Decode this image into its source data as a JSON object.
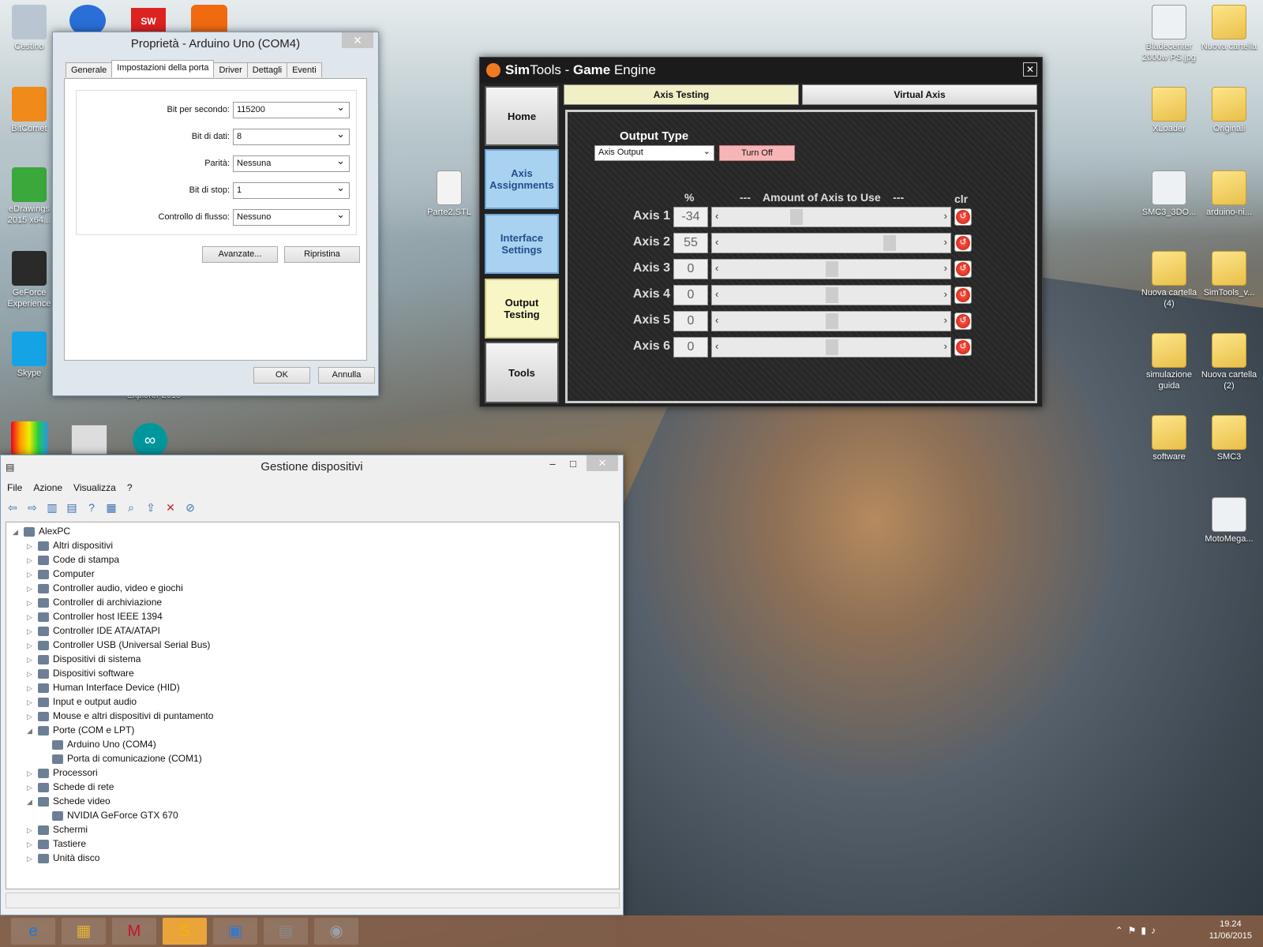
{
  "desktop": {
    "left_icons": [
      {
        "label": "Cestino",
        "icon": "recycle-bin-icon"
      },
      {
        "label": "BitComet",
        "icon": "bitcomet-icon"
      },
      {
        "label": "eDrawings 2015 x64...",
        "icon": "edrawings-icon"
      },
      {
        "label": "GeForce Experience",
        "icon": "geforce-icon"
      },
      {
        "label": "Skype",
        "icon": "skype-icon"
      }
    ],
    "right_icons": [
      {
        "label": "Bladecenter 2000w PS.jpg",
        "icon": "image-file-icon"
      },
      {
        "label": "Nuova cartella",
        "icon": "folder-icon"
      },
      {
        "label": "XLoader",
        "icon": "folder-icon"
      },
      {
        "label": "Originali",
        "icon": "folder-icon"
      },
      {
        "label": "SMC3_3DO...",
        "icon": "image-file-icon"
      },
      {
        "label": "arduino-ni...",
        "icon": "folder-icon"
      },
      {
        "label": "Nuova cartella (4)",
        "icon": "folder-icon"
      },
      {
        "label": "SimTools_v...",
        "icon": "zip-folder-icon"
      },
      {
        "label": "simulazione guida",
        "icon": "folder-icon"
      },
      {
        "label": "Nuova cartella (2)",
        "icon": "folder-icon"
      },
      {
        "label": "software",
        "icon": "folder-icon"
      },
      {
        "label": "SMC3",
        "icon": "folder-icon"
      },
      {
        "label": "MotoMega...",
        "icon": "image-file-icon"
      }
    ],
    "middle_icon": {
      "label": "Parte2.STL",
      "icon": "stl-file-icon"
    },
    "partial_label": "Explorer 2015"
  },
  "prop": {
    "title": "Proprietà - Arduino Uno (COM4)",
    "close": "✕",
    "tabs": [
      "Generale",
      "Impostazioni della porta",
      "Driver",
      "Dettagli",
      "Eventi"
    ],
    "fields": [
      {
        "label": "Bit per secondo:",
        "value": "115200"
      },
      {
        "label": "Bit di dati:",
        "value": "8"
      },
      {
        "label": "Parità:",
        "value": "Nessuna"
      },
      {
        "label": "Bit di stop:",
        "value": "1"
      },
      {
        "label": "Controllo di flusso:",
        "value": "Nessuno"
      }
    ],
    "advanced": "Avanzate...",
    "restore": "Ripristina",
    "ok": "OK",
    "cancel": "Annulla"
  },
  "sim": {
    "title_a": "Sim",
    "title_b": "Tools - ",
    "title_c": "Game",
    "title_d": " Engine",
    "close": "✕",
    "nav": [
      "Home",
      "Axis Assignments",
      "Interface Settings",
      "Output Testing",
      "Tools"
    ],
    "top_tabs": [
      "Axis Testing",
      "Virtual Axis"
    ],
    "output_type_label": "Output Type",
    "output_select": "Axis Output",
    "turn_off": "Turn Off",
    "col_pct": "%",
    "col_amount": "---    Amount of Axis to Use    ---",
    "col_clr": "clr",
    "axes": [
      {
        "label": "Axis 1",
        "value": "-34",
        "level": -34
      },
      {
        "label": "Axis 2",
        "value": "55",
        "level": 55
      },
      {
        "label": "Axis 3",
        "value": "0",
        "level": 0
      },
      {
        "label": "Axis 4",
        "value": "0",
        "level": 0
      },
      {
        "label": "Axis 5",
        "value": "0",
        "level": 0
      },
      {
        "label": "Axis 6",
        "value": "0",
        "level": 0
      }
    ],
    "accent": "#f07a20"
  },
  "dm": {
    "title": "Gestione dispositivi",
    "menu": [
      "File",
      "Azione",
      "Visualizza",
      "?"
    ],
    "tree": [
      {
        "text": "AlexPC",
        "depth": 0,
        "arrow": "◢"
      },
      {
        "text": "Altri dispositivi",
        "depth": 1,
        "arrow": "▷"
      },
      {
        "text": "Code di stampa",
        "depth": 1,
        "arrow": "▷"
      },
      {
        "text": "Computer",
        "depth": 1,
        "arrow": "▷"
      },
      {
        "text": "Controller audio, video e giochi",
        "depth": 1,
        "arrow": "▷"
      },
      {
        "text": "Controller di archiviazione",
        "depth": 1,
        "arrow": "▷"
      },
      {
        "text": "Controller host IEEE 1394",
        "depth": 1,
        "arrow": "▷"
      },
      {
        "text": "Controller IDE ATA/ATAPI",
        "depth": 1,
        "arrow": "▷"
      },
      {
        "text": "Controller USB (Universal Serial Bus)",
        "depth": 1,
        "arrow": "▷"
      },
      {
        "text": "Dispositivi di sistema",
        "depth": 1,
        "arrow": "▷"
      },
      {
        "text": "Dispositivi software",
        "depth": 1,
        "arrow": "▷"
      },
      {
        "text": "Human Interface Device (HID)",
        "depth": 1,
        "arrow": "▷"
      },
      {
        "text": "Input e output audio",
        "depth": 1,
        "arrow": "▷"
      },
      {
        "text": "Mouse e altri dispositivi di puntamento",
        "depth": 1,
        "arrow": "▷"
      },
      {
        "text": "Porte (COM e LPT)",
        "depth": 1,
        "arrow": "◢"
      },
      {
        "text": "Arduino Uno (COM4)",
        "depth": 2,
        "arrow": ""
      },
      {
        "text": "Porta di comunicazione (COM1)",
        "depth": 2,
        "arrow": ""
      },
      {
        "text": "Processori",
        "depth": 1,
        "arrow": "▷"
      },
      {
        "text": "Schede di rete",
        "depth": 1,
        "arrow": "▷"
      },
      {
        "text": "Schede video",
        "depth": 1,
        "arrow": "◢"
      },
      {
        "text": "NVIDIA GeForce GTX 670",
        "depth": 2,
        "arrow": ""
      },
      {
        "text": "Schermi",
        "depth": 1,
        "arrow": "▷"
      },
      {
        "text": "Tastiere",
        "depth": 1,
        "arrow": "▷"
      },
      {
        "text": "Unità disco",
        "depth": 1,
        "arrow": "▷"
      }
    ],
    "min": "–",
    "max": "□",
    "close": "✕"
  },
  "taskbar": {
    "apps": [
      {
        "icon": "internet-explorer-icon",
        "glyph": "e"
      },
      {
        "icon": "file-explorer-icon",
        "glyph": "▦"
      },
      {
        "icon": "mcafee-icon",
        "glyph": "M"
      },
      {
        "icon": "skype-icon",
        "glyph": "S"
      },
      {
        "icon": "control-panel-icon",
        "glyph": "▣"
      },
      {
        "icon": "device-manager-icon",
        "glyph": "▤"
      },
      {
        "icon": "paint-icon",
        "glyph": "◉"
      }
    ],
    "time": "19.24",
    "date": "11/06/2015"
  }
}
